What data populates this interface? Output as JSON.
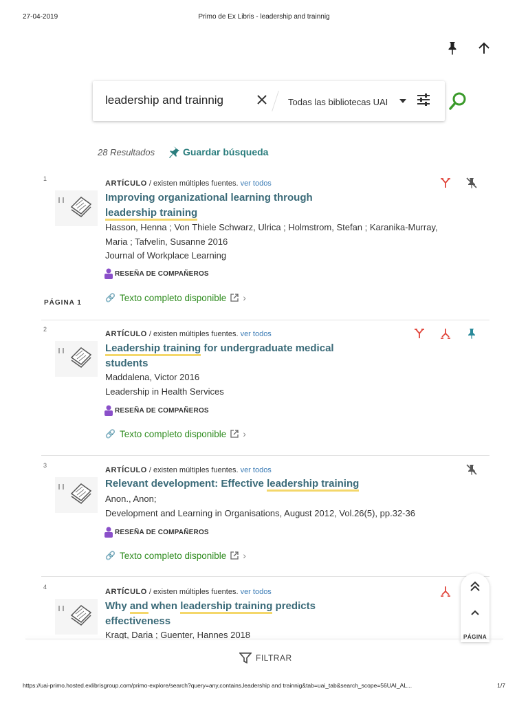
{
  "print_header": {
    "date": "27-04-2019",
    "title": "Primo de Ex Libris - leadership and trainnig"
  },
  "search": {
    "query": "leadership and trainnig",
    "scope": "Todas las bibliotecas UAI"
  },
  "summary": {
    "count": "28 Resultados",
    "save": "Guardar búsqueda"
  },
  "page_label": "PÁGINA 1",
  "results": [
    {
      "num": "1",
      "type": "ARTÍCULO",
      "sources": " / existen múltiples fuentes. ",
      "see_all": "ver todos",
      "title_parts": [
        "Improving organizational learning through",
        "leadership training"
      ],
      "authors": "Hasson, Henna ; Von Thiele Schwarz, Ulrica ; Holmstrom, Stefan ; Karanika-Murray, Maria ; Tafvelin, Susanne 2016",
      "source": "Journal of Workplace Learning",
      "peer": "RESEÑA DE COMPAÑEROS",
      "fulltext": "Texto completo disponible"
    },
    {
      "num": "2",
      "type": "ARTÍCULO",
      "sources": " / existen múltiples fuentes. ",
      "see_all": "ver todos",
      "title_parts": [
        "Leadership training",
        " for undergraduate medical students"
      ],
      "authors": "Maddalena, Victor 2016",
      "source": "Leadership in Health Services",
      "peer": "RESEÑA DE COMPAÑEROS",
      "fulltext": "Texto completo disponible"
    },
    {
      "num": "3",
      "type": "ARTÍCULO",
      "sources": " / existen múltiples fuentes. ",
      "see_all": "ver todos",
      "title_parts": [
        "Relevant development: Effective ",
        "leadership training"
      ],
      "authors": "Anon., Anon;",
      "source": "Development and Learning in Organisations, August 2012, Vol.26(5), pp.32-36",
      "peer": "RESEÑA DE COMPAÑEROS",
      "fulltext": "Texto completo disponible"
    },
    {
      "num": "4",
      "type": "ARTÍCULO",
      "sources": " / existen múltiples fuentes. ",
      "see_all": "ver todos",
      "title_parts": [
        "Why ",
        "and",
        " when ",
        "leadership training",
        " predicts effectiveness"
      ],
      "authors": "Kragt, Daria ; Guenter, Hannes 2018"
    }
  ],
  "page_nav": {
    "label": "PÁGINA"
  },
  "filter": {
    "label": "FILTRAR"
  },
  "print_footer": {
    "url": "https://uai-primo.hosted.exlibrisgroup.com/primo-explore/search?query=any,contains,leadership and trainnig&tab=uai_tab&search_scope=56UAI_AL...",
    "page": "1/7"
  },
  "colors": {
    "accent": "#2a7d7d",
    "link": "#3a7bb5",
    "fulltext": "#2e8b1e",
    "highlight": "#f4d76a",
    "citation": "#e0443a",
    "peer": "#8a4fc9"
  },
  "icons": [
    "pin-icon",
    "arrow-up-icon",
    "close-icon",
    "tune-icon",
    "search-icon",
    "cited-by-icon",
    "citation-icon",
    "unpin-icon",
    "link-icon",
    "external-link-icon",
    "filter-icon",
    "double-chevron-up-icon",
    "chevron-up-icon",
    "peer-review-icon",
    "thumbnail-icon"
  ]
}
